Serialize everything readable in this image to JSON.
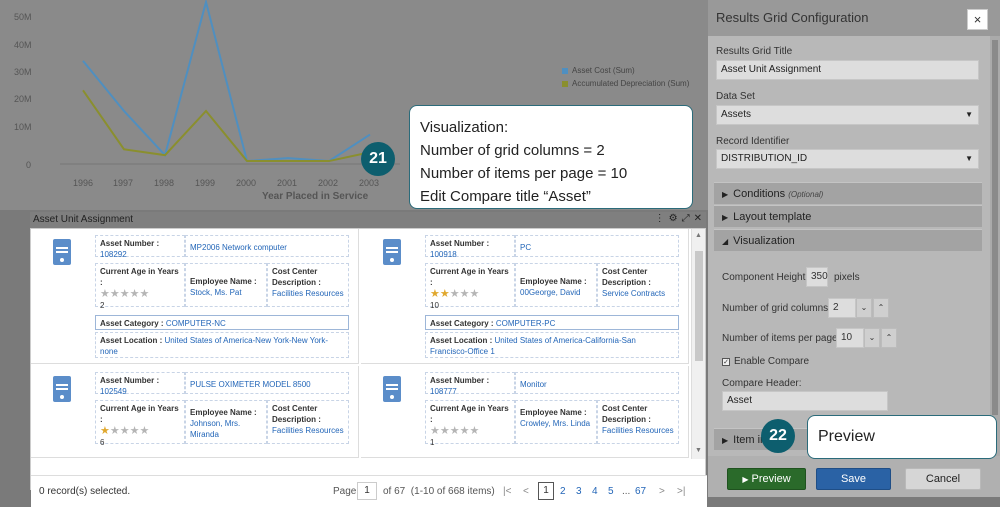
{
  "chart": {
    "type": "line",
    "y_ticks": [
      "50M",
      "40M",
      "30M",
      "20M",
      "10M",
      "0"
    ],
    "x_ticks": [
      "1996",
      "1997",
      "1998",
      "1999",
      "2000",
      "2001",
      "2002",
      "2003"
    ],
    "xlabel": "Year Placed in Service",
    "legend": [
      "Asset Cost (Sum)",
      "Accumulated Depreciation (Sum)"
    ],
    "series_colors": [
      "#4f8fc0",
      "#8a8f2e"
    ]
  },
  "chart_data": {
    "type": "line",
    "x": [
      "1996",
      "1997",
      "1998",
      "1999",
      "2000",
      "2001",
      "2002",
      "2003"
    ],
    "series": [
      {
        "name": "Asset Cost (Sum)",
        "values": [
          35,
          18,
          3,
          55,
          1,
          2,
          1,
          10
        ]
      },
      {
        "name": "Accumulated Depreciation (Sum)",
        "values": [
          25,
          5,
          3,
          18,
          1,
          1,
          1,
          4
        ]
      }
    ],
    "xlabel": "Year Placed in Service",
    "ylim": [
      0,
      55
    ]
  },
  "grid": {
    "title": "Asset Unit Assignment",
    "cards": [
      {
        "asset_number_label": "Asset Number :",
        "asset_number": "108292",
        "name": "MP2006 Network computer",
        "age_label": "Current Age in Years :",
        "age": "2",
        "stars": 0,
        "employee_label": "Employee Name :",
        "employee": "Stock, Ms. Pat",
        "cost_center_label": "Cost Center Description :",
        "cost_center": "Facilities Resources",
        "category_label": "Asset Category :",
        "category": "COMPUTER-NC",
        "location_label": "Asset Location :",
        "location": "United States of America-New York-New York-none"
      },
      {
        "asset_number_label": "Asset Number :",
        "asset_number": "100918",
        "name": "PC",
        "age_label": "Current Age in Years :",
        "age": "10",
        "stars": 2,
        "employee_label": "Employee Name :",
        "employee": "00George, David",
        "cost_center_label": "Cost Center Description :",
        "cost_center": "Service Contracts",
        "category_label": "Asset Category :",
        "category": "COMPUTER-PC",
        "location_label": "Asset Location :",
        "location": "United States of America-California-San Francisco-Office 1"
      },
      {
        "asset_number_label": "Asset Number :",
        "asset_number": "102549",
        "name": "PULSE OXIMETER MODEL 8500",
        "age_label": "Current Age in Years :",
        "age": "6",
        "stars": 1,
        "employee_label": "Employee Name :",
        "employee": "Johnson, Mrs. Miranda",
        "cost_center_label": "Cost Center Description :",
        "cost_center": "Facilities Resources"
      },
      {
        "asset_number_label": "Asset Number :",
        "asset_number": "108777",
        "name": "Monitor",
        "age_label": "Current Age in Years :",
        "age": "1",
        "stars": 0,
        "employee_label": "Employee Name :",
        "employee": "Crowley, Mrs. Linda",
        "cost_center_label": "Cost Center Description :",
        "cost_center": "Facilities Resources"
      }
    ],
    "footer": {
      "selected": "0 record(s) selected.",
      "page_label": "Page",
      "page_value": "1",
      "page_info": "of 67  (1-10 of 668 items)",
      "pages": [
        "1",
        "2",
        "3",
        "4",
        "5",
        "...",
        "67"
      ]
    }
  },
  "config": {
    "title": "Results Grid Configuration",
    "close": "×",
    "results_grid_title_label": "Results Grid Title",
    "results_grid_title": "Asset Unit Assignment",
    "data_set_label": "Data Set",
    "data_set": "Assets",
    "record_identifier_label": "Record Identifier",
    "record_identifier": "DISTRIBUTION_ID",
    "sections": {
      "conditions": "Conditions",
      "conditions_note": "(Optional)",
      "layout_template": "Layout template",
      "visualization": "Visualization",
      "item_image": "Item im"
    },
    "component_height_label": "Component Height:",
    "component_height": "350",
    "component_height_unit": "pixels",
    "grid_columns_label": "Number of grid columns:",
    "grid_columns": "2",
    "items_per_page_label": "Number of items per page:",
    "items_per_page": "10",
    "enable_compare_label": "Enable Compare",
    "compare_header_label": "Compare Header:",
    "compare_header": "Asset",
    "buttons": {
      "preview": "Preview",
      "save": "Save",
      "cancel": "Cancel"
    }
  },
  "callouts": {
    "c21": {
      "number": "21",
      "lines": [
        "Visualization:",
        "Number of grid columns = 2",
        "Number of items per page = 10",
        "Edit Compare title “Asset”"
      ]
    },
    "c22": {
      "number": "22",
      "text": "Preview"
    }
  }
}
